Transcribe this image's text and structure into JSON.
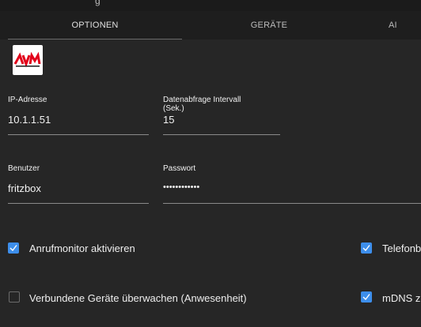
{
  "window": {
    "title": "g"
  },
  "tabs": [
    {
      "label": "OPTIONEN",
      "active": true
    },
    {
      "label": "GERÄTE",
      "active": false
    },
    {
      "label": "AI",
      "active": false
    }
  ],
  "logo": {
    "alt": "AVM"
  },
  "fields": {
    "ip": {
      "label": "IP-Adresse",
      "value": "10.1.1.51"
    },
    "interval": {
      "label_line1": "Datenabfrage Intervall",
      "label_line2": "(Sek.)",
      "value": "15"
    },
    "user": {
      "label": "Benutzer",
      "value": "fritzbox"
    },
    "password": {
      "label": "Passwort",
      "value": "••••••••••••"
    }
  },
  "checkboxes": [
    {
      "label": "Anrufmonitor aktivieren",
      "checked": true
    },
    {
      "label": "Verbundene Geräte überwachen (Anwesenheit)",
      "checked": false
    },
    {
      "label": "Telefonb",
      "checked": true
    },
    {
      "label": "mDNS z",
      "checked": true
    }
  ],
  "colors": {
    "accent": "#3d8eeb",
    "background": "#262626",
    "tabbar": "#1e1e1e"
  }
}
